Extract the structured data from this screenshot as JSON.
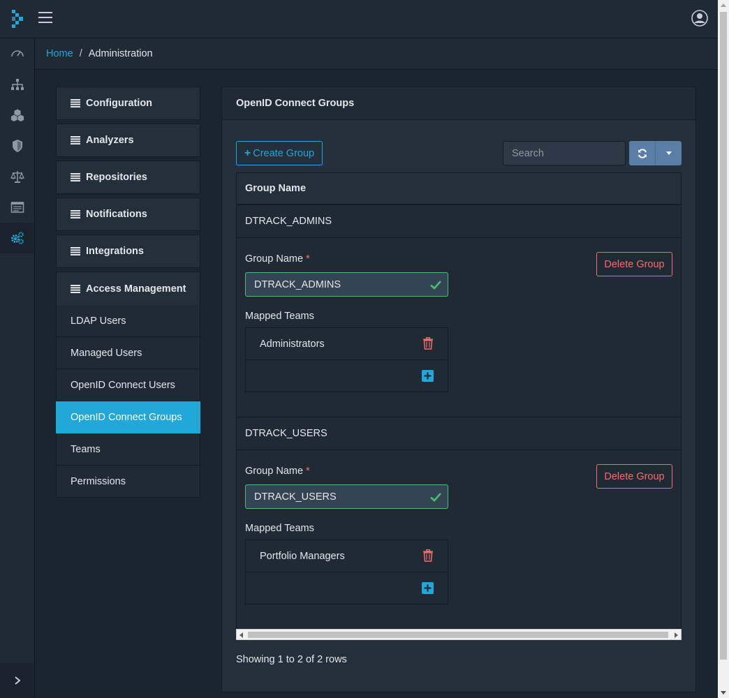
{
  "header": {
    "logo_icon": "dependency-track-logo",
    "menu_icon": "hamburger-icon",
    "user_icon": "user-circle-icon"
  },
  "sidebar": {
    "items": [
      {
        "icon": "dashboard-icon"
      },
      {
        "icon": "projects-icon"
      },
      {
        "icon": "components-icon"
      },
      {
        "icon": "vulnerabilities-icon"
      },
      {
        "icon": "licenses-icon"
      },
      {
        "icon": "tags-icon"
      },
      {
        "icon": "administration-icon",
        "active": true
      }
    ],
    "toggle_icon": "chevron-right-icon"
  },
  "breadcrumb": {
    "home": "Home",
    "separator": "/",
    "current": "Administration"
  },
  "admin_menu": {
    "sections": [
      {
        "label": "Configuration"
      },
      {
        "label": "Analyzers"
      },
      {
        "label": "Repositories"
      },
      {
        "label": "Notifications"
      },
      {
        "label": "Integrations"
      },
      {
        "label": "Access Management"
      }
    ],
    "access_items": [
      {
        "label": "LDAP Users"
      },
      {
        "label": "Managed Users"
      },
      {
        "label": "OpenID Connect Users"
      },
      {
        "label": "OpenID Connect Groups",
        "active": true
      },
      {
        "label": "Teams"
      },
      {
        "label": "Permissions"
      }
    ]
  },
  "card": {
    "title": "OpenID Connect Groups",
    "create_button": "Create Group",
    "search_placeholder": "Search",
    "table_header": "Group Name",
    "groups": [
      {
        "name": "DTRACK_ADMINS",
        "field_label": "Group Name",
        "required_mark": "*",
        "field_value": "DTRACK_ADMINS",
        "delete_button": "Delete Group",
        "mapped_label": "Mapped Teams",
        "teams": [
          "Administrators"
        ]
      },
      {
        "name": "DTRACK_USERS",
        "field_label": "Group Name",
        "required_mark": "*",
        "field_value": "DTRACK_USERS",
        "delete_button": "Delete Group",
        "mapped_label": "Mapped Teams",
        "teams": [
          "Portfolio Managers"
        ]
      }
    ],
    "pagination_text": "Showing 1 to 2 of 2 rows"
  },
  "colors": {
    "accent": "#20a8d8",
    "danger": "#f86c6b",
    "success": "#4dbd74",
    "refresh_button": "#5b7ea6"
  }
}
